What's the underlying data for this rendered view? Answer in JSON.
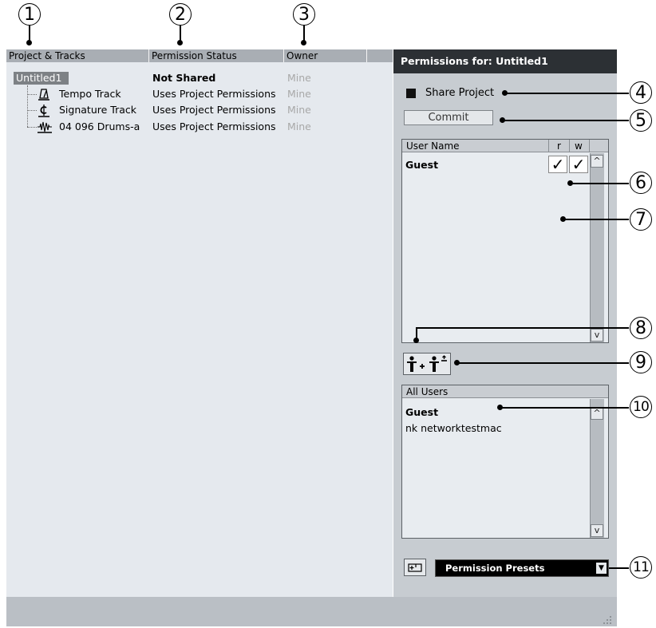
{
  "callouts": [
    "1",
    "2",
    "3",
    "4",
    "5",
    "6",
    "7",
    "8",
    "9",
    "10",
    "11"
  ],
  "columns": {
    "project": "Project & Tracks",
    "status": "Permission Status",
    "owner": "Owner"
  },
  "project": {
    "name": "Untitled1",
    "status": "Not Shared",
    "owner": "Mine"
  },
  "tracks": [
    {
      "name": "Tempo Track",
      "icon": "metronome-icon",
      "status": "Uses Project Permissions",
      "owner": "Mine"
    },
    {
      "name": "Signature Track",
      "icon": "signature-icon",
      "status": "Uses Project Permissions",
      "owner": "Mine"
    },
    {
      "name": "04 096 Drums-a",
      "icon": "audio-waveform-icon",
      "status": "Uses Project Permissions",
      "owner": "Mine"
    }
  ],
  "permissions_panel": {
    "title": "Permissions for: Untitled1",
    "share_project_label": "Share Project",
    "share_project_checked": false,
    "commit_label": "Commit",
    "user_list": {
      "header_name": "User Name",
      "header_r": "r",
      "header_w": "w",
      "users": [
        {
          "name": "Guest",
          "read": true,
          "write": true
        }
      ]
    },
    "add_user_icon": "add-user-icon",
    "remove_user_icon": "remove-user-icon",
    "all_users": {
      "header": "All Users",
      "users": [
        "Guest",
        "nk networktestmac"
      ]
    },
    "presets_label": "Permission Presets"
  },
  "check_glyph": "✓",
  "colors": {
    "title_bar": "#2c3034",
    "left_bg": "#e5e9ee",
    "right_bg": "#c7ccd1",
    "header_bg": "#a9aeb4"
  }
}
